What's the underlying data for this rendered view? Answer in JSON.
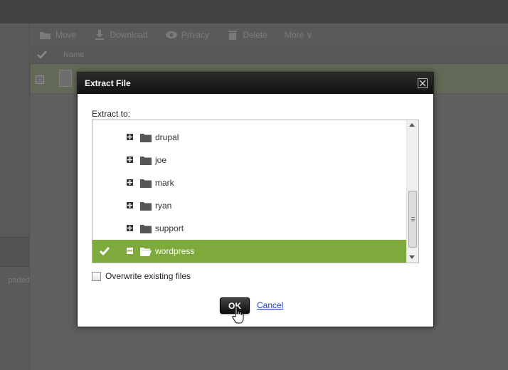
{
  "background": {
    "toolbar": [
      {
        "label": "Move",
        "icon": "move-icon"
      },
      {
        "label": "Download",
        "icon": "download-icon"
      },
      {
        "label": "Privacy",
        "icon": "eye-icon"
      },
      {
        "label": "Delete",
        "icon": "trash-icon"
      },
      {
        "label": "More ∨",
        "icon": ""
      }
    ],
    "list_header_name": "Name",
    "left_fragment_text": "paded"
  },
  "dialog": {
    "title": "Extract File",
    "extract_label": "Extract to:",
    "folders": [
      {
        "name": "drupal",
        "expander": "+",
        "selected": false
      },
      {
        "name": "joe",
        "expander": "+",
        "selected": false
      },
      {
        "name": "mark",
        "expander": "+",
        "selected": false
      },
      {
        "name": "ryan",
        "expander": "+",
        "selected": false
      },
      {
        "name": "support",
        "expander": "+",
        "selected": false
      },
      {
        "name": "wordpress",
        "expander": "−",
        "selected": true
      }
    ],
    "overwrite_label": "Overwrite existing files",
    "overwrite_checked": false,
    "ok_label": "OK",
    "cancel_label": "Cancel"
  },
  "colors": {
    "selection": "#7daa3a",
    "titlebar": "#1a1a1a",
    "link": "#1a3fc1"
  }
}
